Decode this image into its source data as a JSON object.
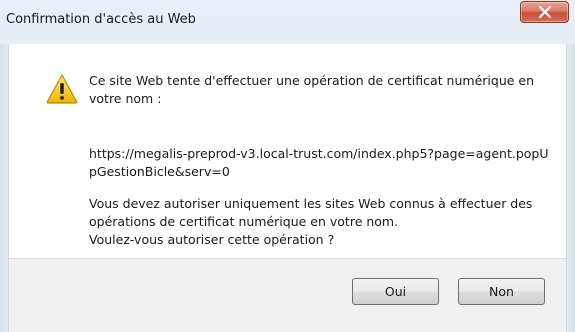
{
  "window": {
    "title": "Confirmation d'accès au Web",
    "close_icon": "close-x-icon"
  },
  "dialog": {
    "icon": "warning-icon",
    "message_intro": "Ce site Web tente d'effectuer une opération de certificat numérique en votre nom :",
    "url": "https://megalis-preprod-v3.local-trust.com/index.php5?page=agent.popUpGestionBicle&serv=0",
    "message_advice": "Vous devez autoriser uniquement les sites Web connus à effectuer des opérations de certificat numérique en votre nom.",
    "message_question": "Voulez-vous autoriser cette opération ?"
  },
  "buttons": {
    "yes_label": "Oui",
    "no_label": "Non"
  },
  "colors": {
    "warning_fill": "#f5c400",
    "close_button": "#c8503a"
  }
}
